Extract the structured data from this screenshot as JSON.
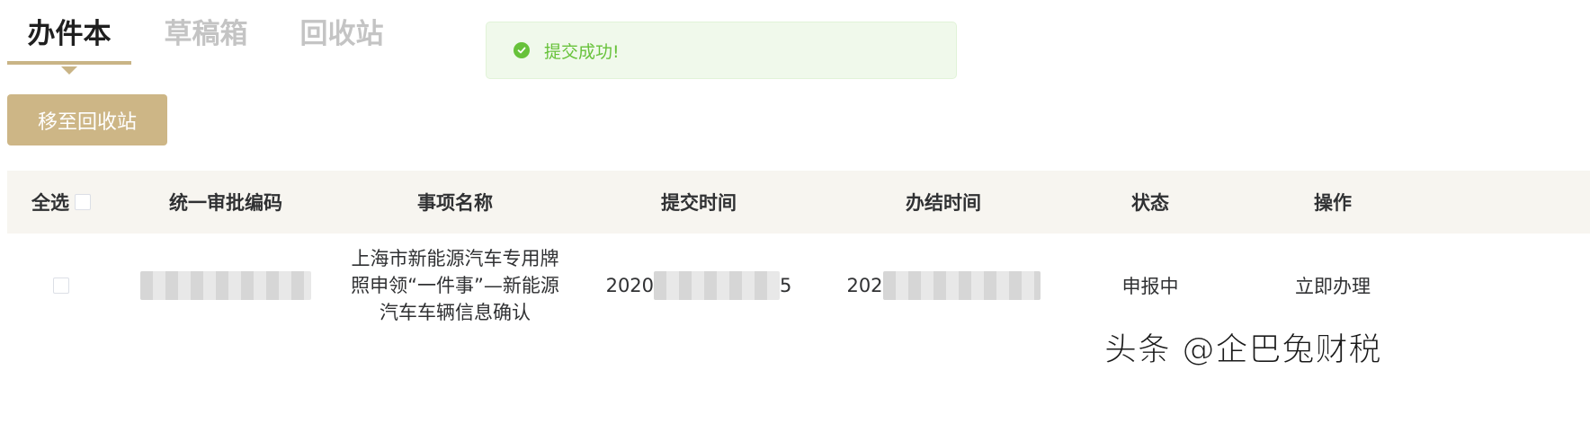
{
  "tabs": [
    {
      "label": "办件本",
      "active": true
    },
    {
      "label": "草稿箱",
      "active": false
    },
    {
      "label": "回收站",
      "active": false
    }
  ],
  "toast": {
    "message": "提交成功!",
    "icon": "check-circle-icon",
    "color": "#67c23a"
  },
  "toolbar": {
    "move_label": "移至回收站"
  },
  "table": {
    "columns": {
      "select_all": "全选",
      "code": "统一审批编码",
      "name": "事项名称",
      "submit_time": "提交时间",
      "finish_time": "办结时间",
      "status": "状态",
      "action": "操作"
    },
    "rows": [
      {
        "name": "上海市新能源汽车专用牌照申领“一件事”—新能源汽车车辆信息确认",
        "submit_time_visible": "2020",
        "submit_time_suffix": "5",
        "finish_time_visible": "202",
        "status": "申报中",
        "action": "立即办理"
      }
    ]
  },
  "watermark": "头条 @企巴兔财税",
  "colors": {
    "accent": "#cdb686",
    "header_bg": "#f7f5f0",
    "success": "#67c23a"
  }
}
